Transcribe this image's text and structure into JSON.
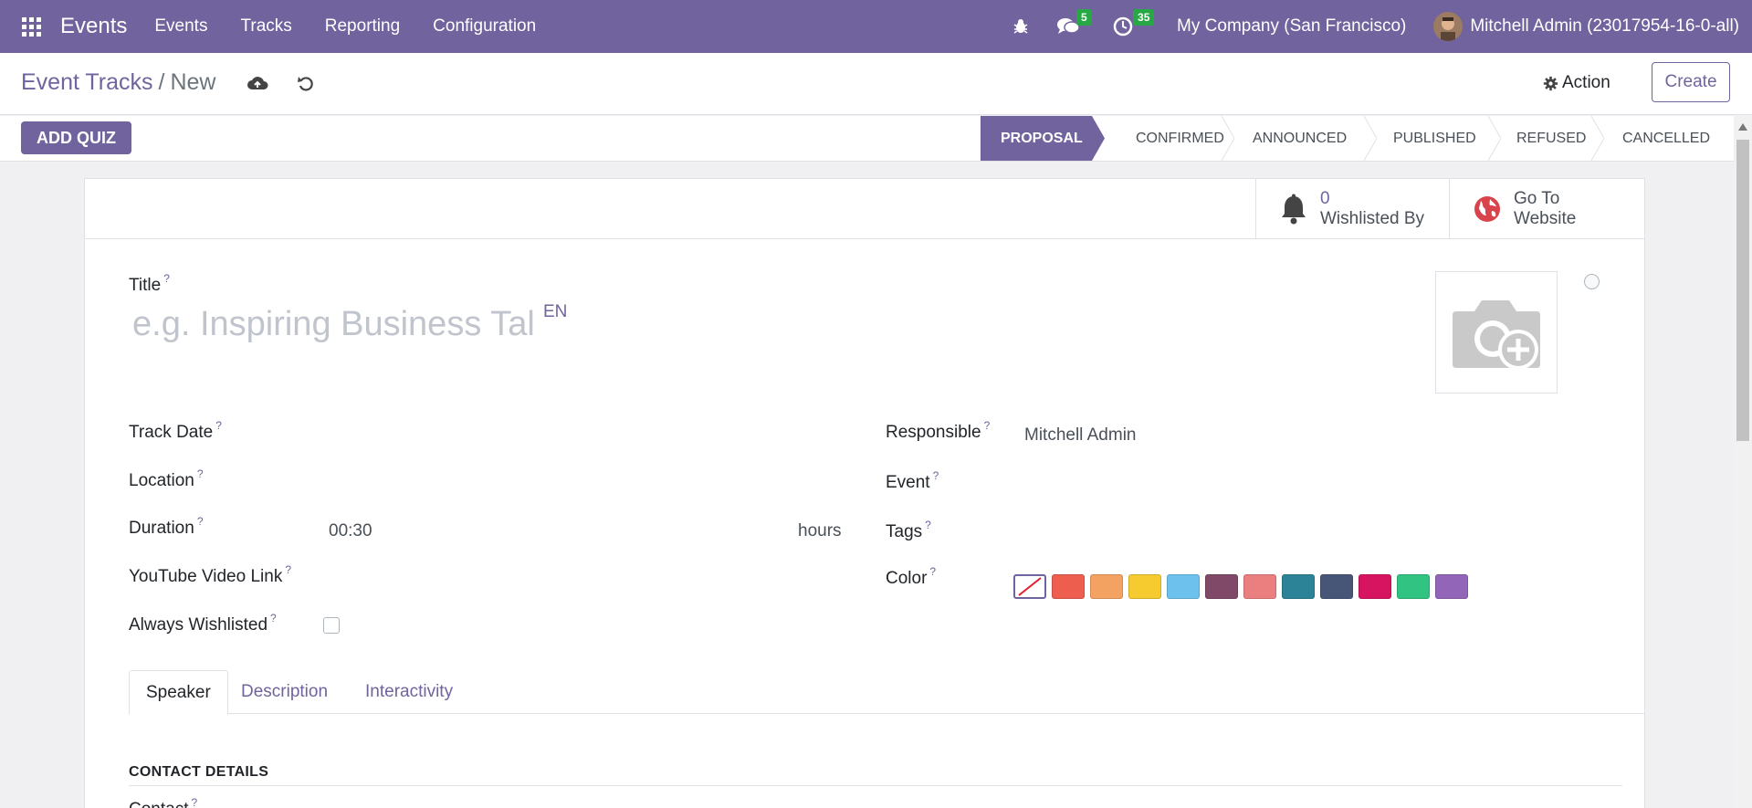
{
  "navbar": {
    "brand": "Events",
    "menus": [
      "Events",
      "Tracks",
      "Reporting",
      "Configuration"
    ],
    "messages_count": "5",
    "activities_count": "35",
    "company": "My Company (San Francisco)",
    "user": "Mitchell Admin (23017954-16-0-all)"
  },
  "control": {
    "breadcrumb_parent": "Event Tracks",
    "breadcrumb_sep": "/",
    "breadcrumb_current": "New",
    "action_label": "Action",
    "create_label": "Create"
  },
  "statusbar": {
    "add_quiz": "ADD QUIZ",
    "stages": [
      "PROPOSAL",
      "CONFIRMED",
      "ANNOUNCED",
      "PUBLISHED",
      "REFUSED",
      "CANCELLED"
    ],
    "active_stage": "PROPOSAL"
  },
  "smart_buttons": {
    "wishlisted_count": "0",
    "wishlisted_label": "Wishlisted By",
    "website_line1": "Go To",
    "website_line2": "Website"
  },
  "form": {
    "title_label": "Title",
    "title_placeholder": "e.g. Inspiring Business Talk",
    "lang": "EN",
    "help_mark": "?",
    "track_date_label": "Track Date",
    "location_label": "Location",
    "duration_label": "Duration",
    "duration_value": "00:30",
    "duration_unit": "hours",
    "youtube_label": "YouTube Video Link",
    "always_wishlisted_label": "Always Wishlisted",
    "responsible_label": "Responsible",
    "responsible_value": "Mitchell Admin",
    "event_label": "Event",
    "tags_label": "Tags",
    "color_label": "Color",
    "colors": [
      "#ffffff",
      "#ee5e4f",
      "#f4a261",
      "#f6cb2f",
      "#6cc1ed",
      "#814968",
      "#eb7e7f",
      "#2c8397",
      "#475577",
      "#d6145f",
      "#30c381",
      "#9365b8"
    ]
  },
  "tabs": [
    "Speaker",
    "Description",
    "Interactivity"
  ],
  "section": {
    "contact_details": "CONTACT DETAILS",
    "partial_label": "Contact"
  }
}
